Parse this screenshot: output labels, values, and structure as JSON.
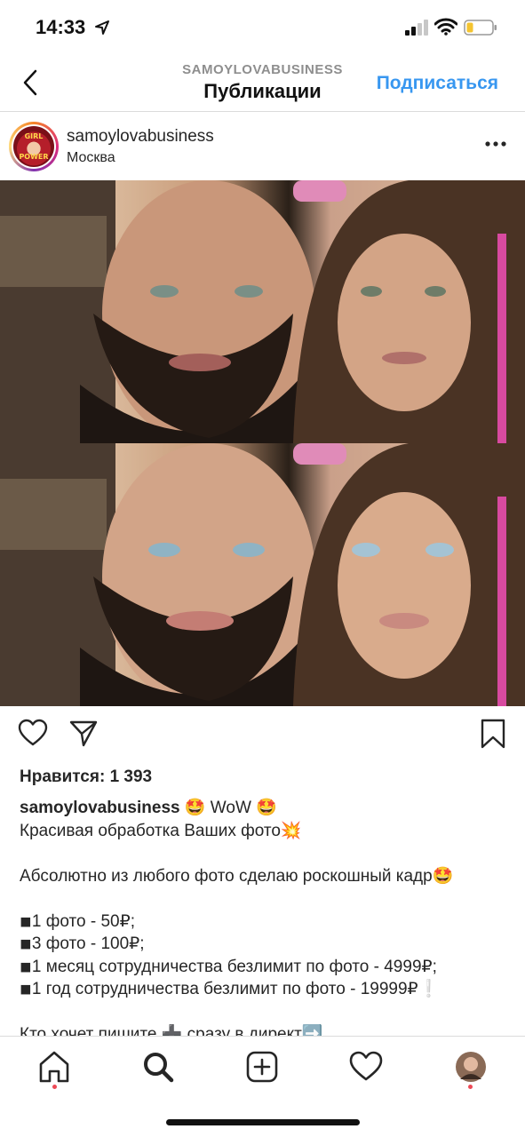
{
  "status_bar": {
    "time": "14:33"
  },
  "header": {
    "account": "SAMOYLOVABUSINESS",
    "title": "Публикации",
    "follow_label": "Подписаться"
  },
  "post": {
    "username": "samoylovabusiness",
    "location": "Москва",
    "avatar_text_top": "GIRL",
    "avatar_text_bottom": "POWER",
    "likes": "Нравится: 1 393",
    "caption": {
      "username": "samoylovabusiness",
      "first_line": " 🤩 WoW 🤩",
      "lines": [
        "Красивая обработка Ваших фото💥",
        "",
        "Абсолютно из любого фото сделаю роскошный кадр🤩",
        "",
        "◾1 фото - 50₽;",
        "◾3 фото - 100₽;",
        "◾1 месяц сотрудничества безлимит по фото - 4999₽;",
        "◾1 год сотрудничества безлимит по фото - 19999₽❕",
        "",
        "Кто хочет пишите ➕ сразу в директ➡️"
      ]
    }
  },
  "colors": {
    "accent": "#3897f0",
    "notification": "#ed4956",
    "divider": "#dbdbdb"
  },
  "icons": {
    "status": [
      "location-arrow-icon",
      "signal-icon",
      "wifi-icon",
      "battery-icon"
    ],
    "actions": [
      "heart-icon",
      "share-icon",
      "bookmark-icon"
    ],
    "tabs": [
      "home-icon",
      "search-icon",
      "add-post-icon",
      "activity-heart-icon",
      "profile-avatar-icon"
    ]
  }
}
